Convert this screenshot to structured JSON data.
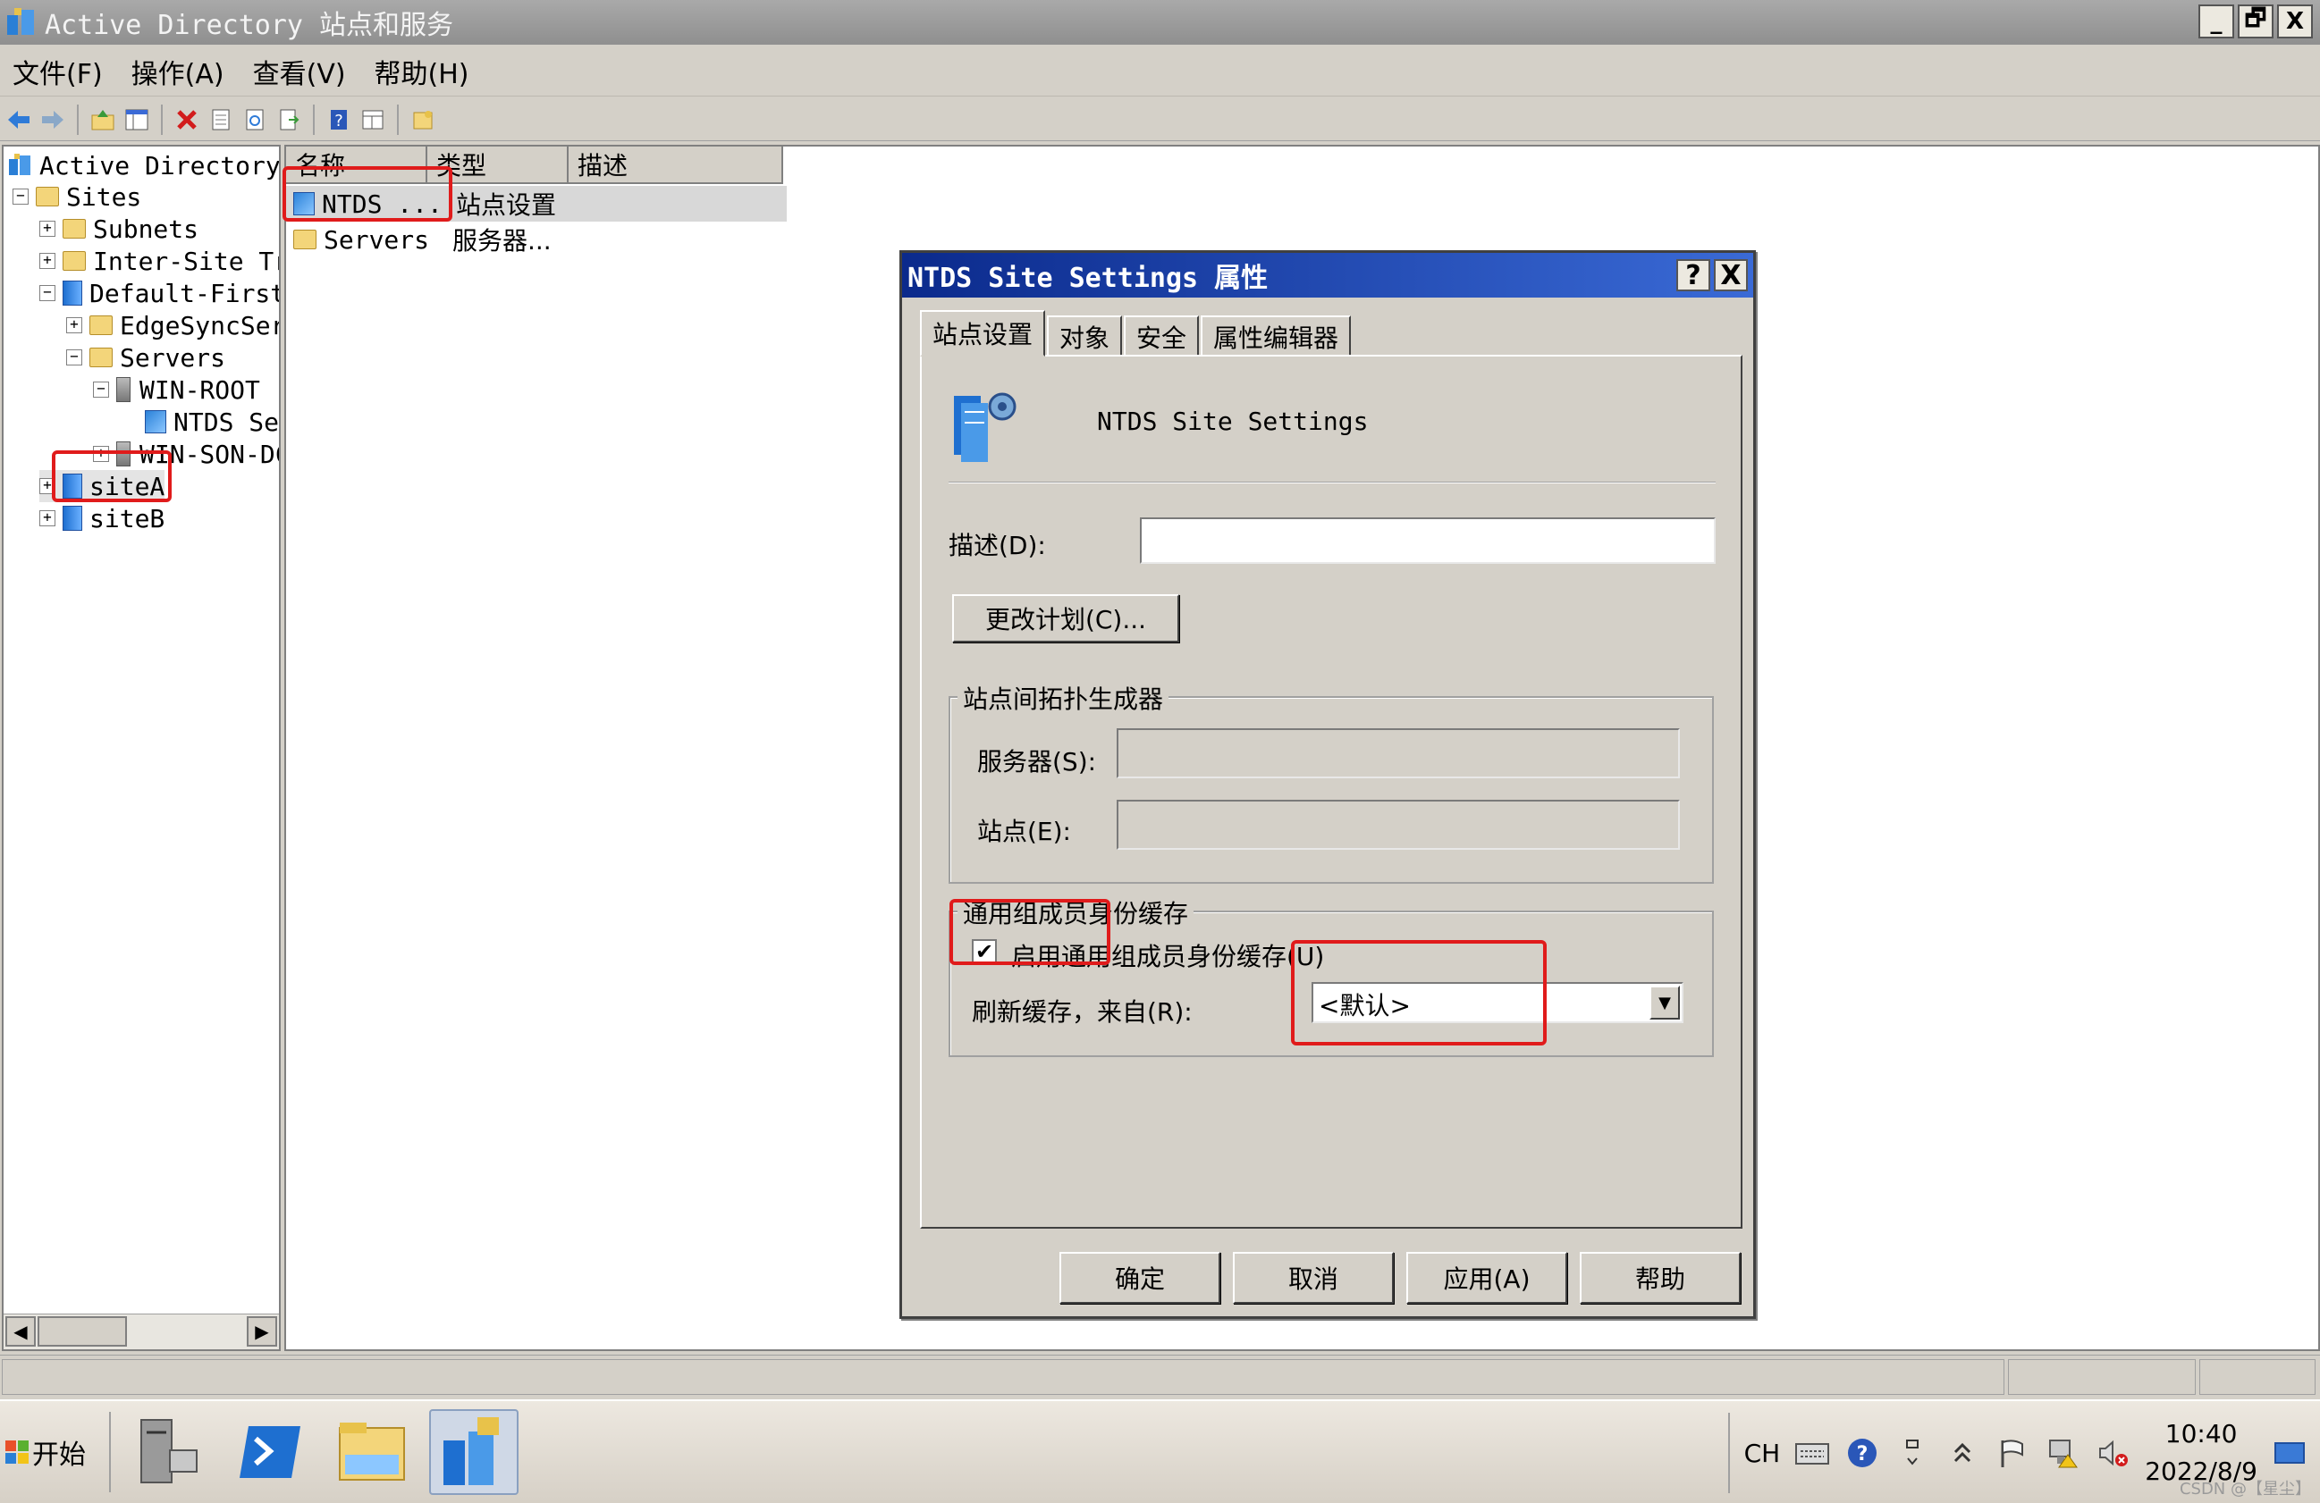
{
  "window": {
    "title": "Active Directory 站点和服务",
    "minimize": "_",
    "restore": "🗗",
    "close": "X"
  },
  "menu": [
    "文件(F)",
    "操作(A)",
    "查看(V)",
    "帮助(H)"
  ],
  "toolbar_icons": [
    "back-arrow-icon",
    "forward-arrow-icon",
    "up-folder-icon",
    "show-tree-icon",
    "delete-icon",
    "properties-icon",
    "refresh-icon",
    "export-icon",
    "help-icon",
    "view-icon",
    "new-icon"
  ],
  "tree": {
    "root": "Active Directory 站",
    "items": [
      {
        "label": "Sites",
        "exp": "−"
      },
      {
        "label": "Subnets",
        "exp": "+"
      },
      {
        "label": "Inter-Site Tran",
        "exp": "+"
      },
      {
        "label": "Default-First-S",
        "exp": "−"
      },
      {
        "label": "EdgeSyncServ:",
        "exp": "+"
      },
      {
        "label": "Servers",
        "exp": "−"
      },
      {
        "label": "WIN-ROOT",
        "exp": "−"
      },
      {
        "label": "NTDS Set",
        "exp": ""
      },
      {
        "label": "WIN-SON-DC",
        "exp": "+"
      },
      {
        "label": "siteA",
        "exp": "+"
      },
      {
        "label": "siteB",
        "exp": "+"
      }
    ]
  },
  "list": {
    "columns": [
      "名称",
      "类型",
      "描述"
    ],
    "rows": [
      {
        "name": "NTDS ...",
        "type": "站点设置"
      },
      {
        "name": "Servers",
        "type": "服务器..."
      }
    ]
  },
  "dialog": {
    "title": "NTDS Site Settings 属性",
    "help_btn": "?",
    "close_btn": "X",
    "tabs": [
      "站点设置",
      "对象",
      "安全",
      "属性编辑器"
    ],
    "object_name": "NTDS Site Settings",
    "description_label": "描述(D):",
    "description_value": "",
    "change_schedule_btn": "更改计划(C)...",
    "istg_group": "站点间拓扑生成器",
    "server_label": "服务器(S):",
    "site_label": "站点(E):",
    "ugmc_group": "通用组成员身份缓存",
    "enable_ugmc_label": "启用通用组成员身份缓存(U)",
    "enable_ugmc_checked": true,
    "check_mark": "✔",
    "refresh_label": "刷新缓存，来自(R):",
    "refresh_value": "<默认>",
    "buttons": [
      "确定",
      "取消",
      "应用(A)",
      "帮助"
    ]
  },
  "taskbar": {
    "start_label": "开始",
    "lang": "CH",
    "time": "10:40",
    "date": "2022/8/9",
    "watermark": "CSDN @【星尘】"
  },
  "colors": {
    "annotation_red": "#e01b1b",
    "dialog_title": "#0b2a8c",
    "face": "#d4d0c8"
  }
}
